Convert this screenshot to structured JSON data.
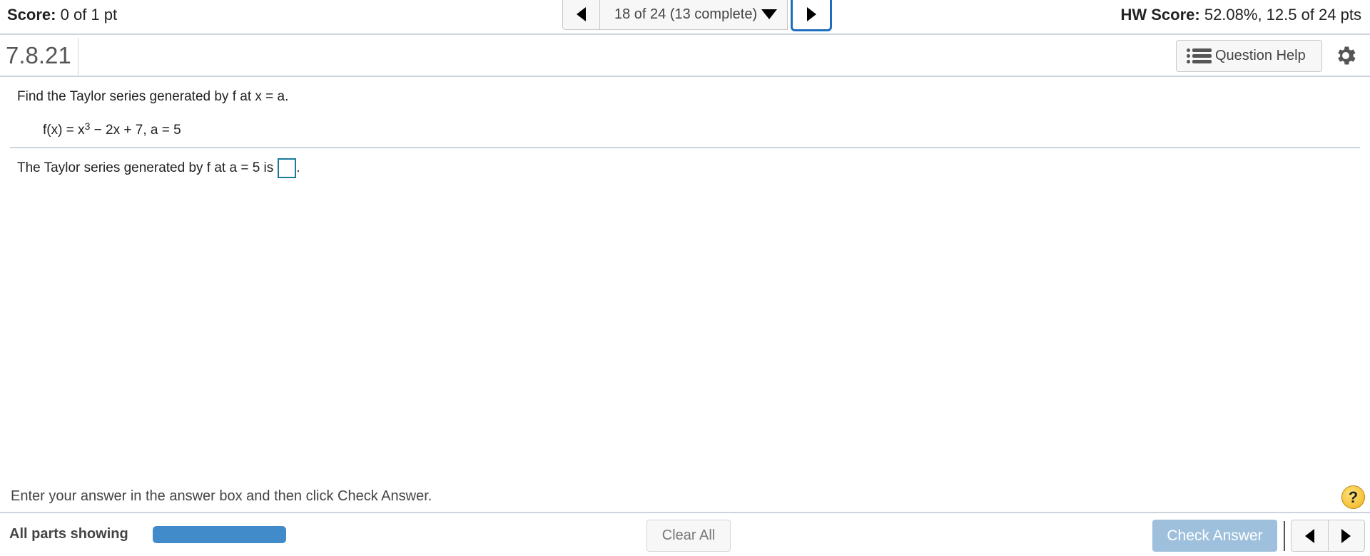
{
  "topbar": {
    "score_label": "Score:",
    "score_value": "0 of 1 pt",
    "navigator": {
      "prev_icon": "triangle-left-icon",
      "selected": "18 of 24 (13 complete)",
      "dropdown_icon": "caret-down-icon",
      "next_icon": "triangle-right-icon"
    },
    "hw_score_label": "HW Score:",
    "hw_score_value": "52.08%, 12.5 of 24 pts"
  },
  "question_header": {
    "number": "7.8.21",
    "help_button": {
      "icon": "list-icon",
      "label": "Question Help"
    },
    "settings_icon": "gear-icon"
  },
  "question": {
    "prompt": "Find the Taylor series generated by f at x = a.",
    "formula_prefix": "f(x) = x",
    "formula_exponent": "3",
    "formula_suffix": " − 2x + 7, a = 5",
    "answer_prefix": "The Taylor series generated by f at a = 5 is",
    "answer_value": "",
    "answer_suffix": "."
  },
  "footer": {
    "instructions": "Enter your answer in the answer box and then click Check Answer.",
    "help_icon": "question-mark-icon",
    "help_symbol": "?",
    "parts_label": "All parts showing",
    "parts_progress_percent": 100,
    "clear_all_label": "Clear All",
    "check_answer_label": "Check Answer",
    "prev_icon": "triangle-left-icon",
    "next_icon": "triangle-right-icon"
  },
  "colors": {
    "accent_blue": "#1f6fbf",
    "progress_blue": "#428bca",
    "check_answer_disabled": "#9ec0dd",
    "answer_box_border": "#1a7a9a",
    "divider": "#cdd3df",
    "help_yellow": "#f0b21a"
  }
}
